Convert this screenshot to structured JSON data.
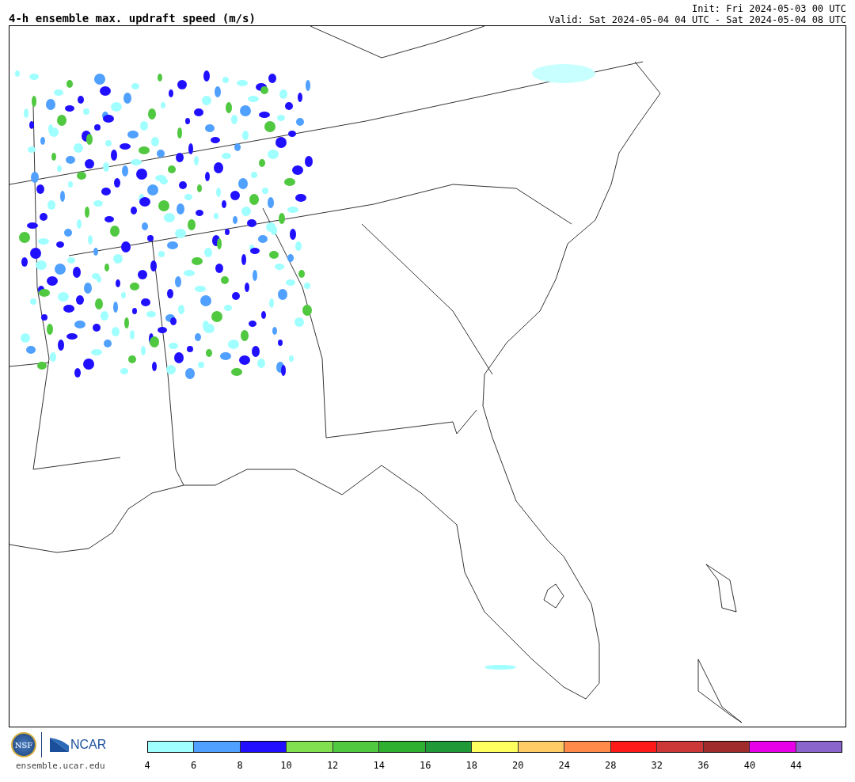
{
  "title": "4-h ensemble max. updraft speed (m/s)",
  "init": "Init: Fri 2024-05-03 00 UTC",
  "valid": "Valid: Sat 2024-05-04 04 UTC - Sat 2024-05-04 08 UTC",
  "footer": {
    "logo_left": "NSF",
    "logo_right": "NCAR",
    "url": "ensemble.ucar.edu"
  },
  "colorbar": {
    "bins": [
      {
        "color": "#a0ffff",
        "label": "4"
      },
      {
        "color": "#50a0ff",
        "label": "6"
      },
      {
        "color": "#2010ff",
        "label": "8"
      },
      {
        "color": "#80e050",
        "label": "10"
      },
      {
        "color": "#50c840",
        "label": "12"
      },
      {
        "color": "#30b030",
        "label": "14"
      },
      {
        "color": "#209a38",
        "label": "16"
      },
      {
        "color": "#ffff60",
        "label": "18"
      },
      {
        "color": "#ffcc66",
        "label": "20"
      },
      {
        "color": "#ff8a4a",
        "label": "24"
      },
      {
        "color": "#ff1a1a",
        "label": "28"
      },
      {
        "color": "#cc3838",
        "label": "32"
      },
      {
        "color": "#a02c2c",
        "label": "36"
      },
      {
        "color": "#e800e8",
        "label": "40"
      },
      {
        "color": "#8a66cc",
        "label": "44"
      }
    ]
  }
}
